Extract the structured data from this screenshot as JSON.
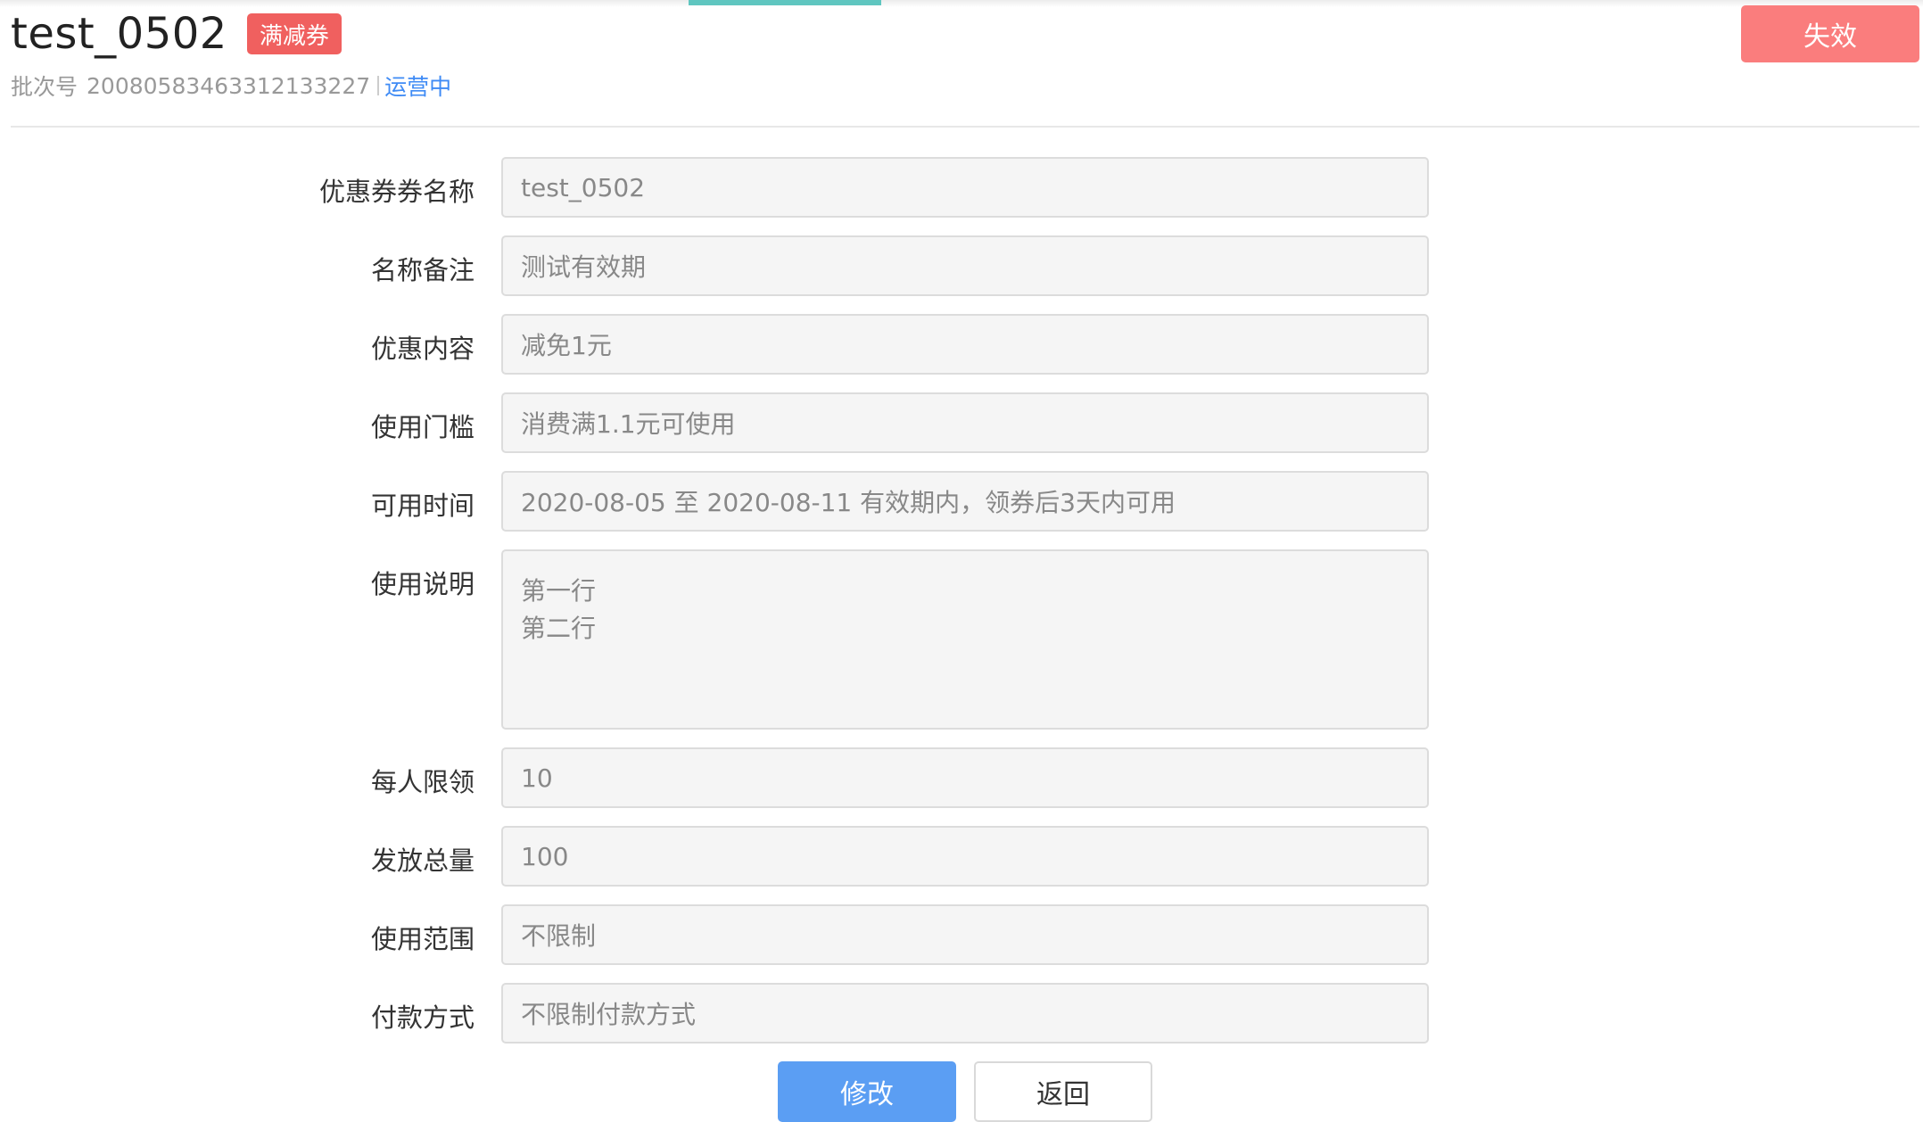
{
  "header": {
    "title": "test_0502",
    "type_badge": "满减券",
    "batch_label": "批次号",
    "batch_number": "20080583463312133227",
    "status": "运营中",
    "invalidate_label": "失效"
  },
  "form": {
    "coupon_name": {
      "label": "优惠券券名称",
      "value": "test_0502"
    },
    "name_remark": {
      "label": "名称备注",
      "value": "测试有效期"
    },
    "discount_content": {
      "label": "优惠内容",
      "value": "减免1元"
    },
    "usage_threshold": {
      "label": "使用门槛",
      "value": "消费满1.1元可使用"
    },
    "available_time": {
      "label": "可用时间",
      "value": "2020-08-05 至 2020-08-11 有效期内，领券后3天内可用"
    },
    "usage_notes": {
      "label": "使用说明",
      "lines": [
        "第一行",
        "第二行"
      ]
    },
    "per_person_limit": {
      "label": "每人限领",
      "value": "10"
    },
    "total_issued": {
      "label": "发放总量",
      "value": "100"
    },
    "usage_scope": {
      "label": "使用范围",
      "value": "不限制"
    },
    "payment_method": {
      "label": "付款方式",
      "value": "不限制付款方式"
    }
  },
  "actions": {
    "modify_label": "修改",
    "back_label": "返回"
  },
  "colors": {
    "badge": "#f0605f",
    "invalidate": "#fa7d7d",
    "primary": "#5b9ef3",
    "status_link": "#3f8bf5",
    "tab_indicator": "#5fc6c0"
  }
}
